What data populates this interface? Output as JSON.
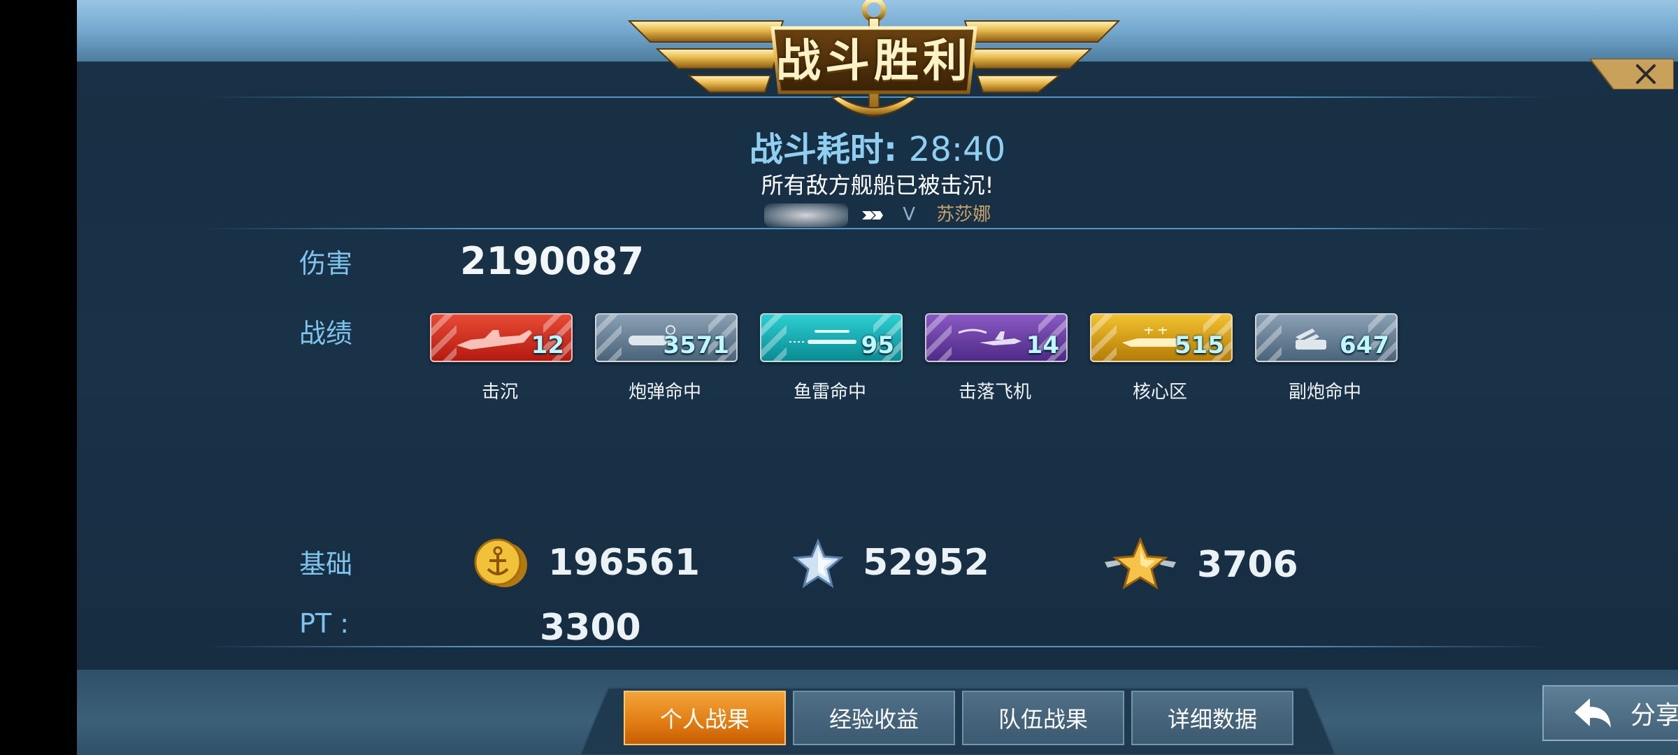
{
  "header": {
    "title": "战斗胜利",
    "battle_time_label": "战斗耗时:",
    "battle_time_value": "28:40",
    "subtitle": "所有敌方舰船已被击沉!",
    "player_level": "V",
    "player_ship": "苏莎娜"
  },
  "labels": {
    "damage": "伤害",
    "record": "战绩",
    "base": "基础",
    "pt": "PT :"
  },
  "damage_value": "2190087",
  "stats": [
    {
      "caption": "击沉",
      "value": "12",
      "color": "#d42a1c",
      "icon": "warship-sink-icon"
    },
    {
      "caption": "炮弹命中",
      "value": "3571",
      "color": "#5f7a93",
      "icon": "shell-icon"
    },
    {
      "caption": "鱼雷命中",
      "value": "95",
      "color": "#11a7ad",
      "icon": "torpedo-icon"
    },
    {
      "caption": "击落飞机",
      "value": "14",
      "color": "#6b3fa3",
      "icon": "plane-icon"
    },
    {
      "caption": "核心区",
      "value": "515",
      "color": "#d79c0d",
      "icon": "core-target-icon"
    },
    {
      "caption": "副炮命中",
      "value": "647",
      "color": "#5d7890",
      "icon": "secondary-gun-icon"
    }
  ],
  "base": {
    "coins": "196561",
    "silver_star": "52952",
    "gold_star": "3706"
  },
  "pt_value": "3300",
  "tabs": [
    {
      "label": "个人战果",
      "active": true
    },
    {
      "label": "经验收益",
      "active": false
    },
    {
      "label": "队伍战果",
      "active": false
    },
    {
      "label": "详细数据",
      "active": false
    }
  ],
  "share_label": "分享",
  "colors": {
    "accent_blue": "#7fc4ec",
    "gold": "#e6b84a",
    "tab_active": "#e07c12"
  }
}
